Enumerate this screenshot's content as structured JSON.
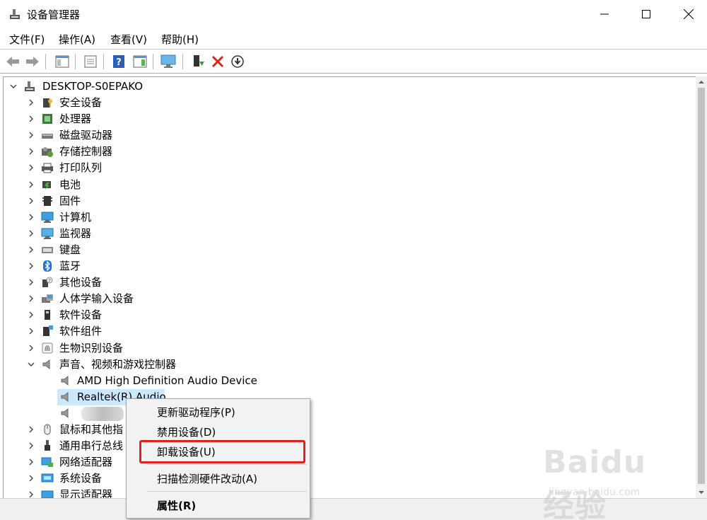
{
  "window": {
    "title": "设备管理器"
  },
  "menu": [
    "文件(F)",
    "操作(A)",
    "查看(V)",
    "帮助(H)"
  ],
  "tree": {
    "root": "DESKTOP-S0EPAKO",
    "categories": [
      {
        "label": "安全设备",
        "icon": "security-device-icon"
      },
      {
        "label": "处理器",
        "icon": "processor-icon"
      },
      {
        "label": "磁盘驱动器",
        "icon": "disk-drive-icon"
      },
      {
        "label": "存储控制器",
        "icon": "storage-controller-icon"
      },
      {
        "label": "打印队列",
        "icon": "printer-icon"
      },
      {
        "label": "电池",
        "icon": "battery-icon"
      },
      {
        "label": "固件",
        "icon": "firmware-icon"
      },
      {
        "label": "计算机",
        "icon": "computer-icon"
      },
      {
        "label": "监视器",
        "icon": "monitor-icon"
      },
      {
        "label": "键盘",
        "icon": "keyboard-icon"
      },
      {
        "label": "蓝牙",
        "icon": "bluetooth-icon"
      },
      {
        "label": "其他设备",
        "icon": "other-device-icon"
      },
      {
        "label": "人体学输入设备",
        "icon": "hid-icon"
      },
      {
        "label": "软件设备",
        "icon": "software-device-icon"
      },
      {
        "label": "软件组件",
        "icon": "software-component-icon"
      },
      {
        "label": "生物识别设备",
        "icon": "biometric-icon"
      },
      {
        "label": "声音、视频和游戏控制器",
        "icon": "speaker-icon",
        "expanded": true
      }
    ],
    "audio_children": [
      "AMD High Definition Audio Device",
      "Realtek(R) Audio",
      ""
    ],
    "after": [
      {
        "label": "鼠标和其他指",
        "icon": "mouse-icon"
      },
      {
        "label": "通用串行总线",
        "icon": "usb-icon"
      },
      {
        "label": "网络适配器",
        "icon": "network-adapter-icon"
      },
      {
        "label": "系统设备",
        "icon": "system-device-icon"
      },
      {
        "label": "显示适配器",
        "icon": "display-adapter-icon"
      }
    ]
  },
  "context_menu": {
    "items": [
      "更新驱动程序(P)",
      "禁用设备(D)",
      "卸载设备(U)",
      "扫描检测硬件改动(A)",
      "属性(R)"
    ]
  },
  "watermark": {
    "brand": "Baidu经验",
    "url": "jingyan.baidu.com"
  },
  "colors": {
    "selection": "#cce8ff",
    "highlight_border": "#e0221b",
    "accent_blue": "#0078d7"
  }
}
